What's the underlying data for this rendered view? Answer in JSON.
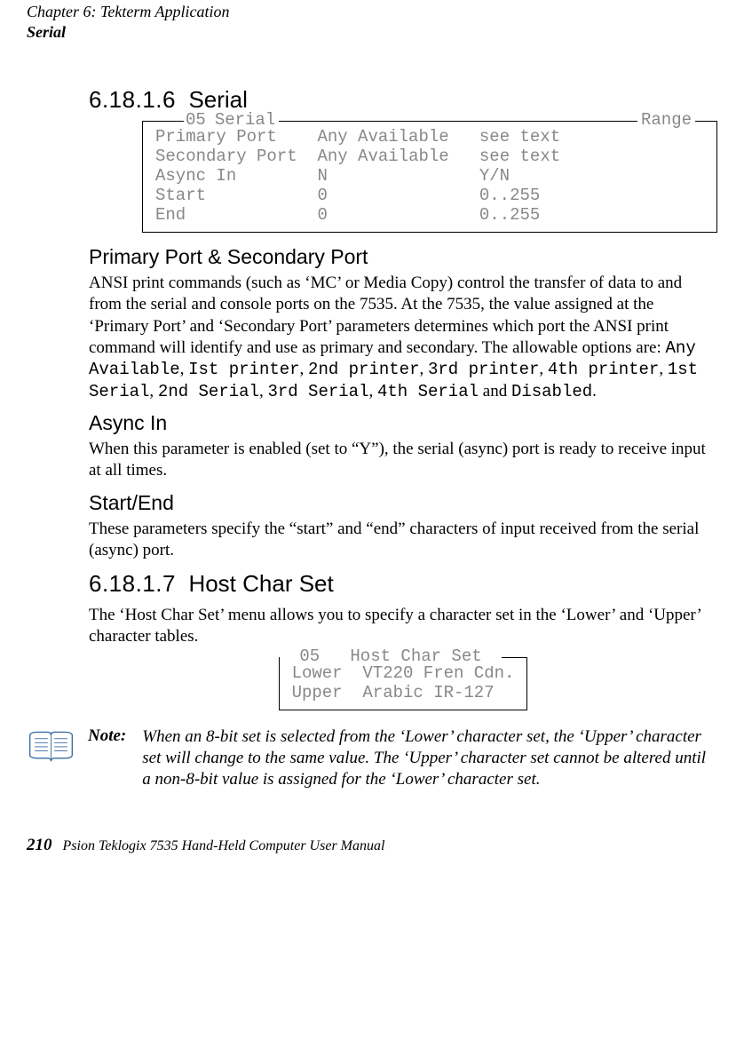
{
  "header": {
    "chapter_line": "Chapter  6:   Tekterm Application",
    "section": "Serial"
  },
  "serial_section": {
    "number": "6.18.1.6",
    "title": "Serial"
  },
  "serial_box": {
    "legend_num": "05",
    "legend_title": "Serial",
    "legend_range": "Range",
    "rows": [
      {
        "label": "Primary Port",
        "value": "Any Available",
        "range": "see text"
      },
      {
        "label": "Secondary Port",
        "value": "Any Available",
        "range": "see text"
      },
      {
        "label": "Async In",
        "value": "N",
        "range": "Y/N"
      },
      {
        "label": "Start",
        "value": "0",
        "range": "0..255"
      },
      {
        "label": "End",
        "value": "0",
        "range": "0..255"
      }
    ]
  },
  "primary_port": {
    "heading": "Primary Port & Secondary Port",
    "p1a": "ANSI print commands (such as ‘MC’ or Media Copy) control the transfer of data to and from the serial and console ports on the 7535. At the 7535, the value assigned at the ‘Primary Port’ and ‘Secondary Port’ parameters determines which port the ANSI print command will identify and use as primary and secondary. The allowable options are: ",
    "code1": "Any Available",
    "sep1": ", ",
    "code2": "Ist printer",
    "sep2": ", ",
    "code3": "2nd printer",
    "sep3": ", ",
    "code4": "3rd printer",
    "sep4": ", ",
    "code5": "4th printer",
    "sep5": ", ",
    "code6": "1st Serial",
    "sep6": ", ",
    "code7": "2nd Serial",
    "sep7": ", ",
    "code8": "3rd Serial",
    "sep8": ", ",
    "code9": "4th Serial",
    "p1b": " and ",
    "code10": "Disabled",
    "p1c": "."
  },
  "async_in": {
    "heading": "Async In",
    "body": "When this parameter is enabled (set to “Y”), the serial (async) port is ready to receive input at all times."
  },
  "start_end": {
    "heading": "Start/End",
    "body": "These parameters specify the “start” and “end” characters of input received from the serial (async) port."
  },
  "host_section": {
    "number": "6.18.1.7",
    "title": "Host Char Set",
    "intro": "The ‘Host Char Set’ menu allows you to specify a character set in the ‘Lower’ and ‘Upper’ character tables."
  },
  "host_box": {
    "legend_num": "05",
    "legend_title": "Host Char Set",
    "rows": [
      {
        "label": "Lower",
        "value": "VT220 Fren Cdn."
      },
      {
        "label": "Upper",
        "value": "Arabic IR-127"
      }
    ]
  },
  "note": {
    "label": "Note:",
    "body": "When an 8-bit set is selected from the ‘Lower’ character set, the ‘Upper’ character set will change to the same value. The ‘Upper’ character set cannot be altered until a non-8-bit value is assigned for the ‘Lower’ character set."
  },
  "footer": {
    "page_num": "210",
    "title": "Psion Teklogix 7535 Hand-Held Computer User Manual"
  }
}
